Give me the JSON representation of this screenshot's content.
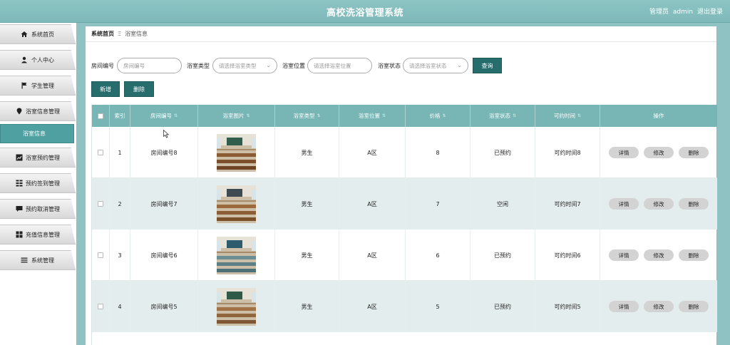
{
  "app": {
    "title": "高校洗浴管理系统"
  },
  "header": {
    "role": "管理员",
    "username": "admin",
    "logout": "退出登录"
  },
  "sidebar": {
    "items": [
      {
        "label": "系统首页",
        "icon": "home-icon"
      },
      {
        "label": "个人中心",
        "icon": "user-icon"
      },
      {
        "label": "学生管理",
        "icon": "flag-icon"
      },
      {
        "label": "浴室信息管理",
        "icon": "location-pin-icon"
      },
      {
        "label": "浴室预约管理",
        "icon": "chart-icon"
      },
      {
        "label": "预约签到管理",
        "icon": "grid-icon"
      },
      {
        "label": "预约取消管理",
        "icon": "message-icon"
      },
      {
        "label": "充值信息管理",
        "icon": "apps-icon"
      },
      {
        "label": "系统管理",
        "icon": "menu-icon"
      }
    ],
    "active_sub": "浴室信息"
  },
  "breadcrumb": {
    "home": "系统首页",
    "separator": "Ξ",
    "current": "浴室信息"
  },
  "filters": {
    "room_no_label": "房间编号",
    "room_no_placeholder": "房间编号",
    "type_label": "浴室类型",
    "type_placeholder": "请选择浴室类型",
    "location_label": "浴室位置",
    "location_placeholder": "请选择浴室位置",
    "status_label": "浴室状态",
    "status_placeholder": "请选择浴室状态",
    "search": "查询"
  },
  "actions": {
    "add": "新增",
    "delete": "删除"
  },
  "table": {
    "columns": [
      "索引",
      "房间编号",
      "浴室图片",
      "浴室类型",
      "浴室位置",
      "价格",
      "浴室状态",
      "可约时间",
      "操作"
    ],
    "rows": [
      {
        "index": "1",
        "room": "房间编号8",
        "type": "男生",
        "location": "A区",
        "price": "8",
        "status": "已预约",
        "time": "可约时间8"
      },
      {
        "index": "2",
        "room": "房间编号7",
        "type": "男生",
        "location": "A区",
        "price": "7",
        "status": "空闲",
        "time": "可约时间7"
      },
      {
        "index": "3",
        "room": "房间编号6",
        "type": "男生",
        "location": "A区",
        "price": "6",
        "status": "已预约",
        "time": "可约时间6"
      },
      {
        "index": "4",
        "room": "房间编号5",
        "type": "男生",
        "location": "A区",
        "price": "5",
        "status": "已预约",
        "time": "可约时间5"
      }
    ],
    "row_actions": {
      "detail": "详情",
      "edit": "修改",
      "delete": "删除"
    }
  },
  "colors": {
    "accent": "#7fb9b9",
    "dark_button": "#286d6d",
    "active_sidebar": "#4fa0a0"
  }
}
